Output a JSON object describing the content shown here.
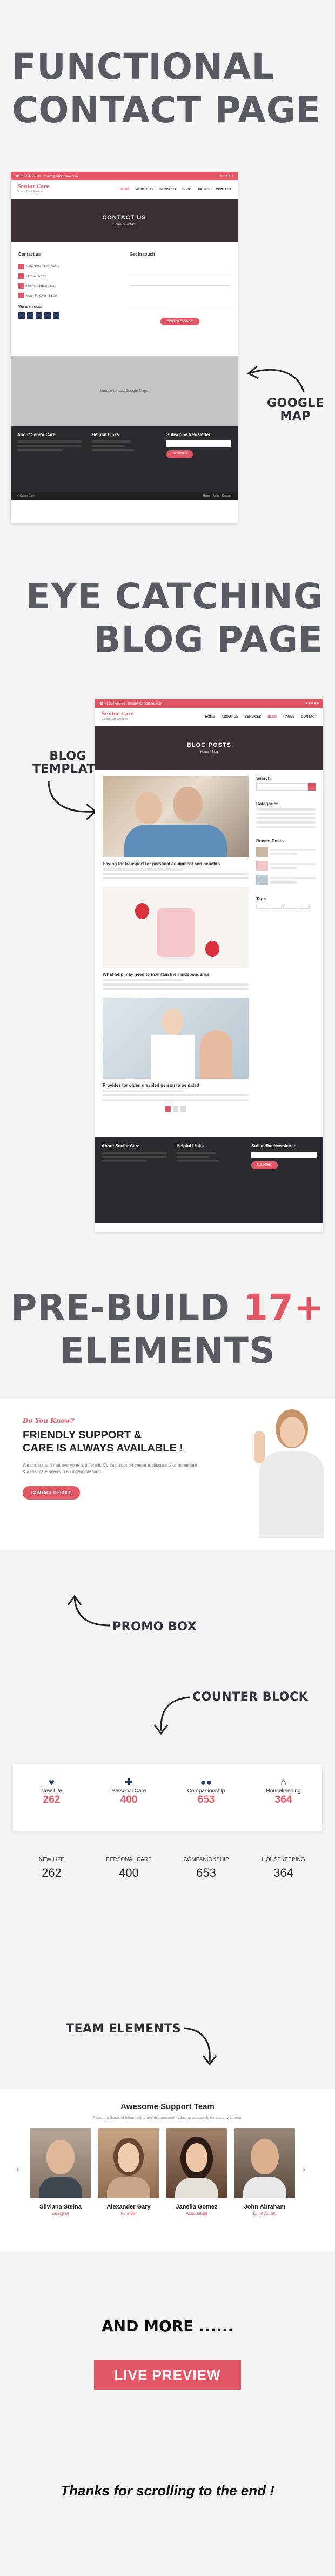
{
  "sections": {
    "contact_heading": [
      "FUNCTIONAL",
      "CONTACT PAGE"
    ],
    "blog_heading": [
      "EYE CATCHING",
      "BLOG PAGE"
    ],
    "elements_heading": {
      "pre": "PRE-BUILD",
      "count": "17+",
      "post": "ELEMENTS"
    }
  },
  "labels": {
    "google_map": [
      "GOOGLE",
      "MAP"
    ],
    "blog_template": [
      "BLOG",
      "TEMPLATE"
    ],
    "promo_box": "PROMO BOX",
    "counter_block": "COUNTER BLOCK",
    "team_elements": "TEAM ELEMENTS",
    "and_more": "AND MORE ......",
    "live_preview": "LIVE PREVIEW",
    "thanks": "Thanks for scrolling to the end !"
  },
  "mock_contact": {
    "logo": "Senior Care",
    "logo_sub": "Elderly Care Services",
    "menu": [
      "HOME",
      "ABOUT US",
      "SERVICES",
      "BLOG",
      "PAGES",
      "CONTACT"
    ],
    "hero_title": "CONTACT US",
    "hero_sub": "Home / Contact",
    "contact_info": "Contact us",
    "get_in_touch": "Get in touch",
    "we_are_social": "We are social",
    "send_button": "SEND MESSAGE",
    "map_text": "Unable to load Google Maps",
    "footer": {
      "about": "About Senior Care",
      "links": "Helpful Links",
      "newsletter": "Subscribe Newsletter",
      "subscribe": "SUBSCRIBE"
    }
  },
  "mock_blog": {
    "hero_title": "BLOG POSTS",
    "hero_sub": "Home / Blog",
    "search": "Search",
    "categories": "Categories",
    "recent_posts": "Recent Posts",
    "tags": "Tags",
    "posts": [
      "Paying for transport for personal equipment and benefits",
      "What help may need to maintain their independence",
      "Provides for older, disabled person to be dated"
    ],
    "footer": {
      "about": "About Senior Care",
      "links": "Helpful Links",
      "newsletter": "Subscribe Newsletter",
      "subscribe": "SUBSCRIBE"
    }
  },
  "promo": {
    "tag": "Do You Know?",
    "title": [
      "FRIENDLY SUPPORT &",
      "CARE IS ALWAYS AVAILABLE !"
    ],
    "body": "We understand that everyone is different. Contact support center to discuss your homecare & assist care needs in an intelligible form.",
    "button": "CONTACT DETAILS"
  },
  "counters_boxed": [
    {
      "label": "New Life",
      "value": "262",
      "icon": "heart-pulse-icon"
    },
    {
      "label": "Personal Care",
      "value": "400",
      "icon": "medkit-icon"
    },
    {
      "label": "Companionship",
      "value": "653",
      "icon": "users-icon"
    },
    {
      "label": "Housekeeping",
      "value": "364",
      "icon": "home-icon"
    }
  ],
  "counters_plain": [
    {
      "label": "NEW LIFE",
      "value": "262"
    },
    {
      "label": "PERSONAL CARE",
      "value": "400"
    },
    {
      "label": "COMPANIONSHIP",
      "value": "653"
    },
    {
      "label": "HOUSEKEEPING",
      "value": "364"
    }
  ],
  "team": {
    "title": "Awesome Support Team",
    "subtitle": "A gamma dividend belonging to any accumulator, reducing probability for security criteria.",
    "members": [
      {
        "name": "Silviana Steina",
        "role": "Designer"
      },
      {
        "name": "Alexander Gary",
        "role": "Founder"
      },
      {
        "name": "Janella Gomez",
        "role": "Accountant"
      },
      {
        "name": "John Abraham",
        "role": "Chief Admin"
      }
    ]
  },
  "colors": {
    "accent": "#e25766",
    "heading": "#595b61",
    "dark": "#2b2b2f"
  }
}
